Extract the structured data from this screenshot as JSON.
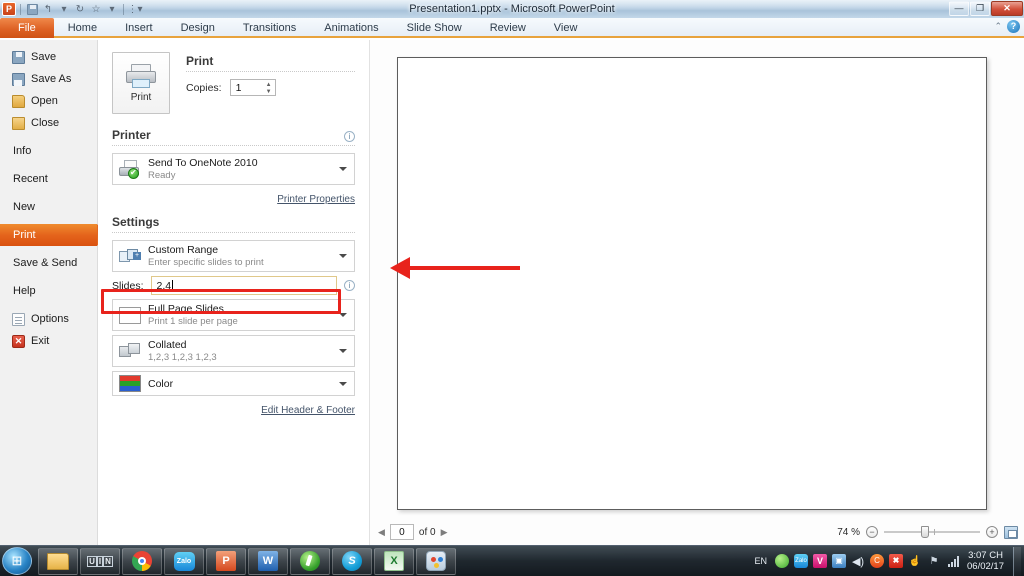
{
  "window": {
    "title": "Presentation1.pptx  -  Microsoft PowerPoint",
    "minimize_label": "—",
    "restore_label": "❐",
    "close_label": "✕"
  },
  "quick_access": {
    "logo_label": "P",
    "save_tip": "Save",
    "undo_glyph": "↰",
    "redo_glyph": "↻",
    "star_glyph": "☆",
    "dropdown_glyph": "▾",
    "customize_glyph": "⋮▾"
  },
  "ribbon": {
    "tabs": [
      {
        "label": "File",
        "active": true
      },
      {
        "label": "Home",
        "active": false
      },
      {
        "label": "Insert",
        "active": false
      },
      {
        "label": "Design",
        "active": false
      },
      {
        "label": "Transitions",
        "active": false
      },
      {
        "label": "Animations",
        "active": false
      },
      {
        "label": "Slide Show",
        "active": false
      },
      {
        "label": "Review",
        "active": false
      },
      {
        "label": "View",
        "active": false
      }
    ],
    "minimize_ribbon_glyph": "⌃",
    "help_glyph": "?"
  },
  "sidebar": {
    "items": [
      {
        "label": "Save",
        "icon": "save-icon"
      },
      {
        "label": "Save As",
        "icon": "save-as-icon"
      },
      {
        "label": "Open",
        "icon": "open-folder-icon"
      },
      {
        "label": "Close",
        "icon": "close-folder-icon"
      },
      {
        "label": "Info",
        "icon": ""
      },
      {
        "label": "Recent",
        "icon": ""
      },
      {
        "label": "New",
        "icon": ""
      },
      {
        "label": "Print",
        "icon": ""
      },
      {
        "label": "Save & Send",
        "icon": ""
      },
      {
        "label": "Help",
        "icon": ""
      },
      {
        "label": "Options",
        "icon": "document-icon"
      },
      {
        "label": "Exit",
        "icon": "exit-icon"
      }
    ],
    "active_index": 7
  },
  "print_pane": {
    "print_button_label": "Print",
    "section_title": "Print",
    "copies_label": "Copies:",
    "copies_value": "1",
    "printer_section_title": "Printer",
    "printer_name": "Send To OneNote 2010",
    "printer_status": "Ready",
    "printer_properties_link": "Printer Properties",
    "settings_section_title": "Settings",
    "settings": [
      {
        "main": "Custom Range",
        "sub": "Enter specific slides to print",
        "icon": "range-icon"
      },
      {
        "main": "Full Page Slides",
        "sub": "Print 1 slide per page",
        "icon": "page-icon"
      },
      {
        "main": "Collated",
        "sub": "1,2,3   1,2,3   1,2,3",
        "icon": "collate-icon"
      },
      {
        "main": "Color",
        "sub": "",
        "icon": "color-icon"
      }
    ],
    "slides_label": "Slides:",
    "slides_value": "2,4",
    "edit_header_footer_link": "Edit Header & Footer",
    "info_glyph": "i"
  },
  "preview": {
    "page_current": "0",
    "page_of_text": "of 0",
    "prev_glyph": "◀",
    "next_glyph": "▶",
    "zoom_percent": "74 %",
    "zoom_out_glyph": "−",
    "zoom_in_glyph": "+",
    "fit_to_window_tip": "Zoom to Page"
  },
  "annotation": {
    "arrow_color": "#E8231C",
    "highlight_color": "#E8231C",
    "points_to": "slides-input"
  },
  "taskbar": {
    "start_glyph": "⊞",
    "items": [
      {
        "name": "windows-explorer",
        "label": ""
      },
      {
        "name": "unikey",
        "label": "UIN"
      },
      {
        "name": "google-chrome",
        "label": ""
      },
      {
        "name": "zalo",
        "label": "Zalo"
      },
      {
        "name": "powerpoint",
        "label": "P"
      },
      {
        "name": "word",
        "label": "W"
      },
      {
        "name": "green-app",
        "label": ""
      },
      {
        "name": "skype",
        "label": "S"
      },
      {
        "name": "excel",
        "label": "X"
      },
      {
        "name": "paint",
        "label": ""
      }
    ],
    "tray": {
      "language": "EN",
      "time": "3:07 CH",
      "date": "06/02/17",
      "speaker_glyph": "🔊",
      "ccleaner_glyph": "C",
      "antivirus_glyph": "A",
      "network_glyph": "⚑",
      "action_glyph": "☝"
    }
  }
}
